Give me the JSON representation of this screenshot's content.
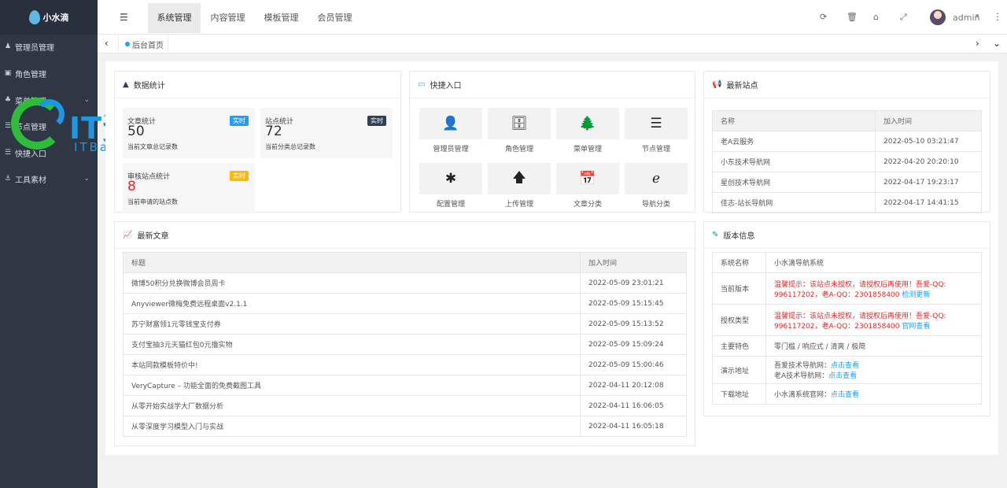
{
  "logo": {
    "text": "小水滴"
  },
  "sidebar": {
    "items": [
      {
        "label": "管理员管理",
        "icon": "user-icon",
        "glyph": "♟",
        "has_children": false
      },
      {
        "label": "角色管理",
        "icon": "role-icon",
        "glyph": "▣",
        "has_children": false
      },
      {
        "label": "菜单管理",
        "icon": "tree-icon",
        "glyph": "♣",
        "has_children": true
      },
      {
        "label": "节点管理",
        "icon": "list-icon",
        "glyph": "☰",
        "has_children": false
      },
      {
        "label": "快捷入口",
        "icon": "list-icon",
        "glyph": "☰",
        "has_children": false
      },
      {
        "label": "工具素材",
        "icon": "anchor-icon",
        "glyph": "⚓",
        "has_children": true
      }
    ]
  },
  "watermark": {
    "title": "IT资源网",
    "subtitle": "ITBaiDu.com"
  },
  "topbar": {
    "tabs": [
      "系统管理",
      "内容管理",
      "模板管理",
      "会员管理"
    ],
    "active_tab": 0,
    "user": "admin"
  },
  "tabstrip": {
    "home_tab": "后台首页"
  },
  "stats": {
    "title": "数据统计",
    "items": [
      {
        "label": "文章统计",
        "value": "50",
        "sub": "当前文章总记录数",
        "badge": "实时",
        "badge_color": "#1e9fff"
      },
      {
        "label": "站点统计",
        "value": "72",
        "sub": "当前分类总记录数",
        "badge": "实时",
        "badge_color": "#2f4056"
      },
      {
        "label": "审核站点统计",
        "value": "8",
        "sub": "当前申请的站点数",
        "badge": "实时",
        "badge_color": "#ffb800",
        "value_color": "#e02b2b"
      }
    ]
  },
  "quick": {
    "title": "快捷入口",
    "items": [
      {
        "label": "管理员管理",
        "icon": "user-icon",
        "glyph": "👤"
      },
      {
        "label": "角色管理",
        "icon": "role-icon",
        "glyph": "🗄"
      },
      {
        "label": "菜单管理",
        "icon": "tree-icon",
        "glyph": "🌲"
      },
      {
        "label": "节点管理",
        "icon": "list-icon",
        "glyph": "☰"
      },
      {
        "label": "配置管理",
        "icon": "asterisk-icon",
        "glyph": "✱"
      },
      {
        "label": "上传管理",
        "icon": "arrow-up-icon",
        "glyph": "🡅"
      },
      {
        "label": "文章分类",
        "icon": "calendar-check-icon",
        "glyph": "📅"
      },
      {
        "label": "导航分类",
        "icon": "edge-icon",
        "glyph": "ℯ"
      }
    ]
  },
  "sites": {
    "title": "最新站点",
    "headers": [
      "名称",
      "加入时间"
    ],
    "rows": [
      [
        "老A云服务",
        "2022-05-10 03:21:47"
      ],
      [
        "小东技术导航网",
        "2022-04-20 20:20:10"
      ],
      [
        "星创技术导航网",
        "2022-04-17 19:23:17"
      ],
      [
        "佳志-站长导航网",
        "2022-04-17 14:41:15"
      ]
    ]
  },
  "articles": {
    "title": "最新文章",
    "headers": [
      "标题",
      "加入时间"
    ],
    "rows": [
      [
        "微博50积分兑换微博会员周卡",
        "2022-05-09 23:01:21"
      ],
      [
        "Anyviewer微梅免费远程桌面v2.1.1",
        "2022-05-09 15:15:45"
      ],
      [
        "苏宁财富领1元零钱宝支付券",
        "2022-05-09 15:13:52"
      ],
      [
        "支付宝抽3元天猫红包0元撸实物",
        "2022-05-09 15:09:24"
      ],
      [
        "本站同款模板特价中!",
        "2022-05-09 15:00:46"
      ],
      [
        "VeryCapture – 功能全面的免费截图工具",
        "2022-04-11 20:12:08"
      ],
      [
        "从零开始实战学大厂数据分析",
        "2022-04-11 16:06:05"
      ],
      [
        "从零深度学习模型入门与实战",
        "2022-04-11 16:05:18"
      ]
    ]
  },
  "version": {
    "title": "版本信息",
    "rows": [
      {
        "key": "系统名称",
        "value": "小水滴导航系统"
      },
      {
        "key": "当前版本",
        "warn": "温馨提示：该站点未授权，请授权后再使用！吾爱-QQ: 996117202，老A-QQ：2301858400",
        "link": "检测更新"
      },
      {
        "key": "授权类型",
        "warn": "温馨提示：该站点未授权，请授权后再使用！吾爱-QQ: 996117202，老A-QQ：2301858400",
        "link": "官网查看"
      },
      {
        "key": "主要特色",
        "value": "零门槛 / 响应式 / 清爽 / 极简"
      },
      {
        "key": "演示地址",
        "line1": "吾爱技术导航网：",
        "link1": "点击查看",
        "line2": "老A技术导航网：",
        "link2": "点击查看"
      },
      {
        "key": "下载地址",
        "line1": "小水滴系统官网：",
        "link1": "点击查看"
      }
    ]
  }
}
